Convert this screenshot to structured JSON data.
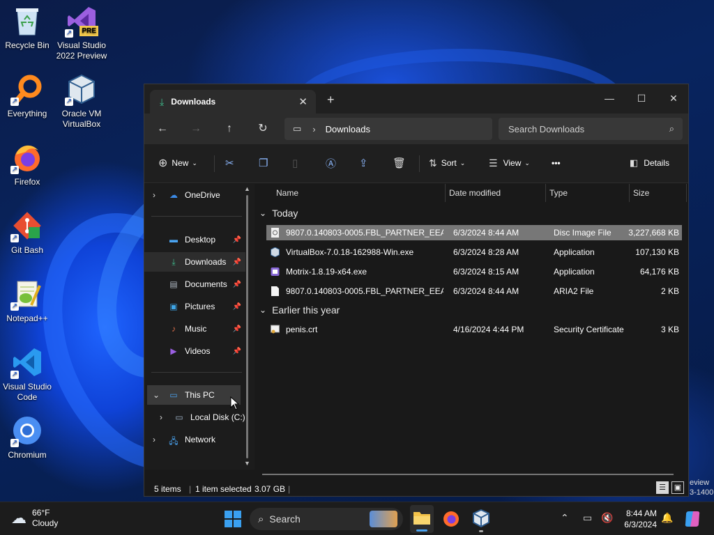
{
  "desktop": {
    "icons": [
      {
        "label": "Recycle Bin"
      },
      {
        "label": "Visual Studio 2022 Preview",
        "badge": "PRE"
      },
      {
        "label": "Everything"
      },
      {
        "label": "Oracle VM VirtualBox"
      },
      {
        "label": "Firefox"
      },
      {
        "label": "Git Bash"
      },
      {
        "label": "Notepad++"
      },
      {
        "label": "Visual Studio Code"
      },
      {
        "label": "Chromium"
      }
    ],
    "watermark": {
      "line1": "eview",
      "line2": "3-1400"
    }
  },
  "window": {
    "tab_title": "Downloads",
    "address": {
      "root_icon": "computer-icon",
      "crumb": "Downloads"
    },
    "search_placeholder": "Search Downloads",
    "toolbar": {
      "new_label": "New",
      "sort_label": "Sort",
      "view_label": "View",
      "more_label": "•••",
      "details_label": "Details"
    },
    "sidebar": {
      "onedrive": "OneDrive",
      "quick": [
        "Desktop",
        "Downloads",
        "Documents",
        "Pictures",
        "Music",
        "Videos"
      ],
      "this_pc": "This PC",
      "local_disk": "Local Disk (C:)",
      "network": "Network"
    },
    "columns": [
      "Name",
      "Date modified",
      "Type",
      "Size"
    ],
    "groups": [
      {
        "title": "Today",
        "files": [
          {
            "name": "9807.0.140803-0005.FBL_PARTNER_EEAP_...",
            "date": "6/3/2024 8:44 AM",
            "type": "Disc Image File",
            "size": "3,227,668 KB",
            "selected": true,
            "icon": "disc-image-icon"
          },
          {
            "name": "VirtualBox-7.0.18-162988-Win.exe",
            "date": "6/3/2024 8:28 AM",
            "type": "Application",
            "size": "107,130 KB",
            "selected": false,
            "icon": "virtualbox-installer-icon"
          },
          {
            "name": "Motrix-1.8.19-x64.exe",
            "date": "6/3/2024 8:15 AM",
            "type": "Application",
            "size": "64,176 KB",
            "selected": false,
            "icon": "motrix-installer-icon"
          },
          {
            "name": "9807.0.140803-0005.FBL_PARTNER_EEAP_...",
            "date": "6/3/2024 8:44 AM",
            "type": "ARIA2 File",
            "size": "2 KB",
            "selected": false,
            "icon": "file-icon"
          }
        ]
      },
      {
        "title": "Earlier this year",
        "files": [
          {
            "name": "penis.crt",
            "date": "4/16/2024 4:44 PM",
            "type": "Security Certificate",
            "size": "3 KB",
            "selected": false,
            "icon": "certificate-icon"
          }
        ]
      }
    ],
    "status": {
      "items": "5 items",
      "selected": "1 item selected",
      "size": "3.07 GB"
    }
  },
  "taskbar": {
    "weather": {
      "temp": "66°F",
      "condition": "Cloudy"
    },
    "search_label": "Search",
    "time": "8:44 AM",
    "date": "6/3/2024"
  }
}
